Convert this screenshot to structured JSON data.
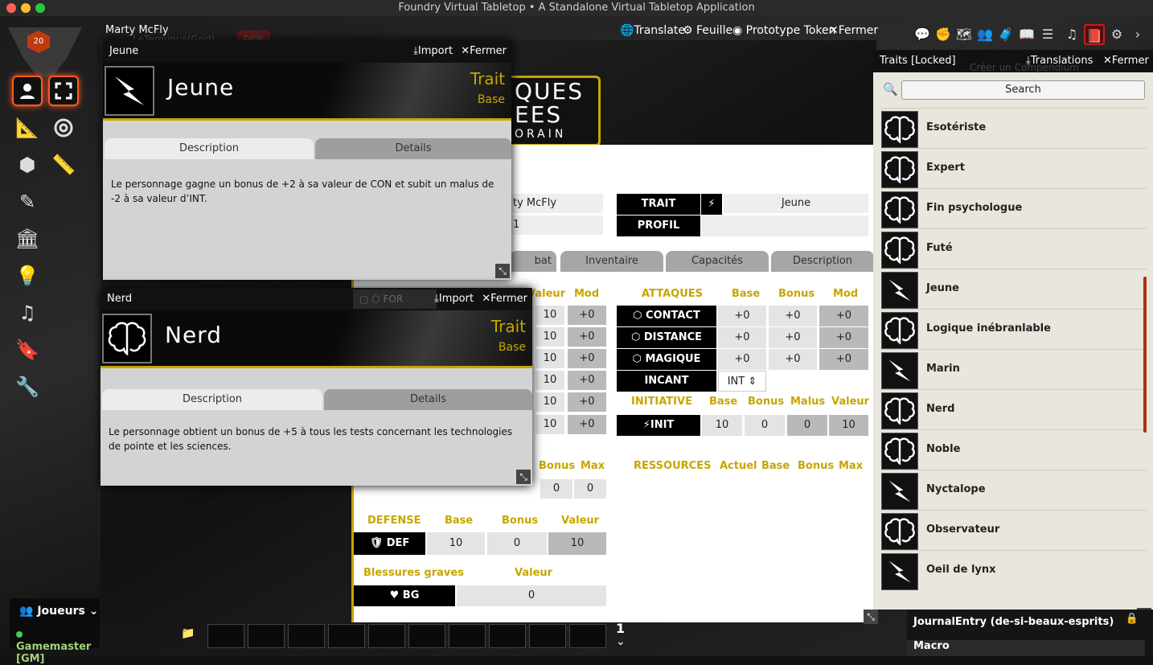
{
  "app": {
    "title": "Foundry Virtual Tabletop • A Standalone Virtual Tabletop Application"
  },
  "sheet": {
    "owner": "Marty McFly",
    "ghost_tab1": "LeTerminus(Grid)",
    "ghost_tab2": "new",
    "actions": {
      "translate": "Translate",
      "feuille": "Feuille",
      "prototype": "Prototype Token",
      "close": "Fermer"
    },
    "logo_lines": [
      "QUES",
      "EES",
      "ORAIN"
    ],
    "name_value": "ty McFly",
    "level_value": "1",
    "trait_label": "TRAIT",
    "trait_value": "Jeune",
    "profil_label": "PROFIL",
    "tabs": [
      "bat",
      "Inventaire",
      "Capacités",
      "Description"
    ],
    "stat_headers": [
      "s",
      "Valeur",
      "Mod"
    ],
    "stat_rows": [
      [
        "10",
        "+0"
      ],
      [
        "10",
        "+0"
      ],
      [
        "10",
        "+0"
      ],
      [
        "10",
        "+0"
      ],
      [
        "10",
        "+0"
      ],
      [
        "10",
        "+0"
      ]
    ],
    "attacks": {
      "title": "ATTAQUES",
      "headers": [
        "Base",
        "Bonus",
        "Mod"
      ],
      "rows": [
        {
          "label": "CONTACT",
          "base": "+0",
          "bonus": "+0",
          "mod": "+0"
        },
        {
          "label": "DISTANCE",
          "base": "+0",
          "bonus": "+0",
          "mod": "+0"
        },
        {
          "label": "MAGIQUE",
          "base": "+0",
          "bonus": "+0",
          "mod": "+0"
        }
      ]
    },
    "incant": {
      "label": "INCANT",
      "value": "INT"
    },
    "initiative": {
      "title": "INITIATIVE",
      "headers": [
        "Base",
        "Bonus",
        "Malus",
        "Valeur"
      ],
      "label": "INIT",
      "values": [
        "10",
        "0",
        "0",
        "10"
      ]
    },
    "res_left": {
      "headers": [
        "Bonus",
        "Max"
      ],
      "values": [
        "0",
        "0"
      ]
    },
    "ressources": {
      "title": "RESSOURCES",
      "headers": [
        "Actuel",
        "Base",
        "Bonus",
        "Max"
      ]
    },
    "defense": {
      "title": "DEFENSE",
      "headers": [
        "Base",
        "Bonus",
        "Valeur"
      ],
      "label": "DEF",
      "values": [
        "10",
        "0",
        "10"
      ]
    },
    "blessures": {
      "title": "Blessures graves",
      "header": "Valeur",
      "label": "BG",
      "value": "0"
    },
    "for_label": "FOR"
  },
  "jeune": {
    "title": "Jeune",
    "import": "Import",
    "close": "Fermer",
    "name": "Jeune",
    "type": "Trait",
    "sub": "Base",
    "tab_desc": "Description",
    "tab_details": "Details",
    "desc": "Le personnage gagne un bonus de +2 à sa valeur de CON et subit un malus de -2 à sa valeur d’INT."
  },
  "nerd": {
    "title": "Nerd",
    "import": "Import",
    "close": "Fermer",
    "name": "Nerd",
    "type": "Trait",
    "sub": "Base",
    "tab_desc": "Description",
    "tab_details": "Details",
    "desc": "Le personnage obtient un bonus de +5 à tous les tests concernant les technologies de pointe et les sciences."
  },
  "compendium": {
    "title": "Traits [Locked]",
    "translations": "Translations",
    "close": "Fermer",
    "behind": "Créer un Compendium",
    "search": "Search",
    "items": [
      {
        "name": "Esotériste",
        "icon": "brain"
      },
      {
        "name": "Expert",
        "icon": "brain"
      },
      {
        "name": "Fin psychologue",
        "icon": "brain"
      },
      {
        "name": "Futé",
        "icon": "brain"
      },
      {
        "name": "Jeune",
        "icon": "bolt"
      },
      {
        "name": "Logique inébranlable",
        "icon": "brain"
      },
      {
        "name": "Marin",
        "icon": "bolt"
      },
      {
        "name": "Nerd",
        "icon": "brain"
      },
      {
        "name": "Noble",
        "icon": "brain"
      },
      {
        "name": "Nyctalope",
        "icon": "bolt"
      },
      {
        "name": "Observateur",
        "icon": "brain"
      },
      {
        "name": "Oeil de lynx",
        "icon": "bolt"
      }
    ]
  },
  "directory": {
    "journal": "JournalEntry (de-si-beaux-esprits)",
    "macro": "Macro"
  },
  "players": {
    "title": "Joueurs",
    "gm": "Gamemaster [GM]"
  },
  "hotbar": {
    "page": "1"
  },
  "colors": {
    "accent": "#c7a500",
    "controls_active": "#ff5a1f",
    "gm_dot": "#39d353"
  }
}
